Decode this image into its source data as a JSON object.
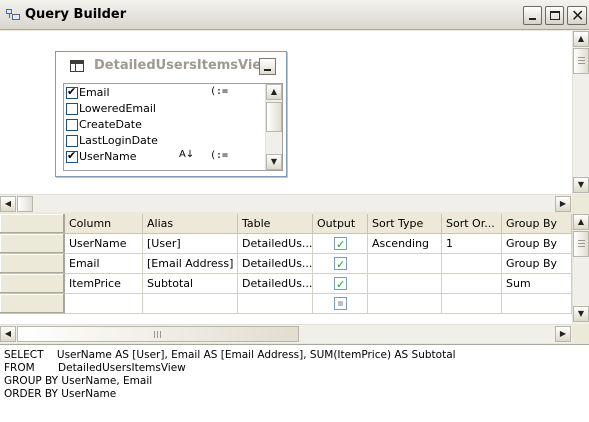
{
  "window": {
    "title": "Query Builder",
    "controls": [
      "minimize-icon",
      "maximize-icon",
      "close-icon"
    ]
  },
  "diagram": {
    "table": {
      "name": "DetailedUsersItemsView",
      "columns": [
        {
          "name": "Email",
          "checked": true,
          "icons": [
            "filter-icon"
          ]
        },
        {
          "name": "LoweredEmail",
          "checked": false
        },
        {
          "name": "CreateDate",
          "checked": false
        },
        {
          "name": "LastLoginDate",
          "checked": false
        },
        {
          "name": "UserName",
          "checked": true,
          "icons": [
            "sort-ascending-icon",
            "filter-icon"
          ]
        }
      ]
    }
  },
  "grid": {
    "headers": [
      "Column",
      "Alias",
      "Table",
      "Output",
      "Sort Type",
      "Sort Or...",
      "Group By"
    ],
    "rows": [
      {
        "column": "UserName",
        "alias": "[User]",
        "table": "DetailedUs...",
        "output": true,
        "sort_type": "Ascending",
        "sort_order": "1",
        "group_by": "Group By"
      },
      {
        "column": "Email",
        "alias": "[Email Address]",
        "table": "DetailedUs...",
        "output": true,
        "sort_type": "",
        "sort_order": "",
        "group_by": "Group By"
      },
      {
        "column": "ItemPrice",
        "alias": "Subtotal",
        "table": "DetailedUs...",
        "output": true,
        "sort_type": "",
        "sort_order": "",
        "group_by": "Sum"
      },
      {
        "column": "",
        "alias": "",
        "table": "",
        "output": null,
        "sort_type": "",
        "sort_order": "",
        "group_by": ""
      }
    ]
  },
  "sql": {
    "lines": [
      "SELECT    UserName AS [User], Email AS [Email Address], SUM(ItemPrice) AS Subtotal",
      "FROM       DetailedUsersItemsView",
      "GROUP BY UserName, Email",
      "ORDER BY UserName"
    ]
  },
  "colors": {
    "chrome": "#ece9d8",
    "pane_bg": "#ffffff",
    "grid_line": "#d4d0c8",
    "checkbox_border": "#7f9db9",
    "check_green": "#21a121"
  }
}
